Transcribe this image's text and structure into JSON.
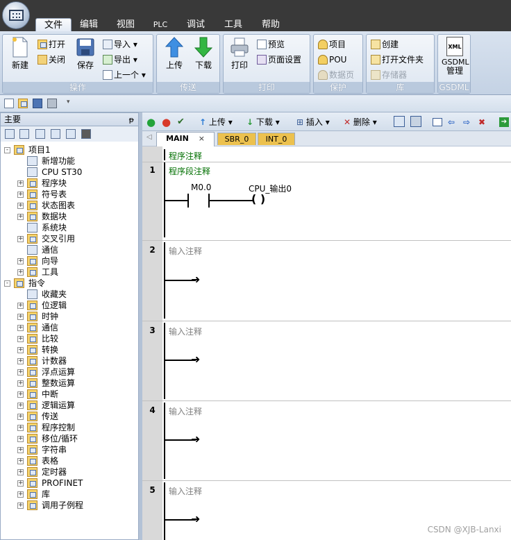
{
  "menu": {
    "items": [
      "文件",
      "编辑",
      "视图",
      "PLC",
      "调试",
      "工具",
      "帮助"
    ],
    "active": "文件"
  },
  "ribbon": {
    "groups": [
      {
        "label": "操作"
      },
      {
        "label": "传送"
      },
      {
        "label": "打印"
      },
      {
        "label": "保护"
      },
      {
        "label": "库"
      },
      {
        "label": "GSDML"
      }
    ],
    "new_label": "新建",
    "open_label": "打开",
    "close_label": "关闭",
    "save_label": "保存",
    "import_label": "导入",
    "export_label": "导出",
    "previous_label": "上一个",
    "upload_label": "上传",
    "download_label": "下载",
    "print_label": "打印",
    "preview_label": "预览",
    "page_setup_label": "页面设置",
    "project_label": "项目",
    "pou_label": "POU",
    "data_page_label": "数据页",
    "create_label": "创建",
    "open_folder_label": "打开文件夹",
    "memory_label": "存储器",
    "gsdml_label_1": "GSDML",
    "gsdml_label_2": "管理",
    "xml_icon_text": "XML"
  },
  "panel": {
    "title": "主要",
    "pin": "ᵽ",
    "tree": [
      {
        "label": "项目1",
        "level": 0,
        "expander": "-"
      },
      {
        "label": "新增功能",
        "level": 1,
        "expander": ""
      },
      {
        "label": "CPU ST30",
        "level": 1,
        "expander": ""
      },
      {
        "label": "程序块",
        "level": 1,
        "expander": "+"
      },
      {
        "label": "符号表",
        "level": 1,
        "expander": "+"
      },
      {
        "label": "状态图表",
        "level": 1,
        "expander": "+"
      },
      {
        "label": "数据块",
        "level": 1,
        "expander": "+"
      },
      {
        "label": "系统块",
        "level": 1,
        "expander": ""
      },
      {
        "label": "交叉引用",
        "level": 1,
        "expander": "+"
      },
      {
        "label": "通信",
        "level": 1,
        "expander": ""
      },
      {
        "label": "向导",
        "level": 1,
        "expander": "+"
      },
      {
        "label": "工具",
        "level": 1,
        "expander": "+"
      },
      {
        "label": "指令",
        "level": 0,
        "expander": "-"
      },
      {
        "label": "收藏夹",
        "level": 1,
        "expander": ""
      },
      {
        "label": "位逻辑",
        "level": 1,
        "expander": "+"
      },
      {
        "label": "时钟",
        "level": 1,
        "expander": "+"
      },
      {
        "label": "通信",
        "level": 1,
        "expander": "+"
      },
      {
        "label": "比较",
        "level": 1,
        "expander": "+"
      },
      {
        "label": "转换",
        "level": 1,
        "expander": "+"
      },
      {
        "label": "计数器",
        "level": 1,
        "expander": "+"
      },
      {
        "label": "浮点运算",
        "level": 1,
        "expander": "+"
      },
      {
        "label": "整数运算",
        "level": 1,
        "expander": "+"
      },
      {
        "label": "中断",
        "level": 1,
        "expander": "+"
      },
      {
        "label": "逻辑运算",
        "level": 1,
        "expander": "+"
      },
      {
        "label": "传送",
        "level": 1,
        "expander": "+"
      },
      {
        "label": "程序控制",
        "level": 1,
        "expander": "+"
      },
      {
        "label": "移位/循环",
        "level": 1,
        "expander": "+"
      },
      {
        "label": "字符串",
        "level": 1,
        "expander": "+"
      },
      {
        "label": "表格",
        "level": 1,
        "expander": "+"
      },
      {
        "label": "定时器",
        "level": 1,
        "expander": "+"
      },
      {
        "label": "PROFINET",
        "level": 1,
        "expander": "+"
      },
      {
        "label": "库",
        "level": 1,
        "expander": "+"
      },
      {
        "label": "调用子例程",
        "level": 1,
        "expander": "+"
      }
    ]
  },
  "editor": {
    "toolbar": {
      "upload": "上传",
      "download": "下载",
      "insert": "插入",
      "delete": "删除"
    },
    "tabs": [
      {
        "label": "MAIN",
        "active": true,
        "close": "×"
      },
      {
        "label": "SBR_0",
        "active": false
      },
      {
        "label": "INT_0",
        "active": false
      }
    ],
    "program_comment": "程序注释",
    "networks": [
      {
        "number": "1",
        "comment": "程序段注释",
        "contact": "M0.0",
        "coil": "CPU_输出0",
        "coil_symbol": "(  )"
      },
      {
        "number": "2",
        "comment": "输入注释"
      },
      {
        "number": "3",
        "comment": "输入注释"
      },
      {
        "number": "4",
        "comment": "输入注释"
      },
      {
        "number": "5",
        "comment": "输入注释"
      }
    ]
  },
  "watermark": "CSDN @XJB-Lanxi",
  "colors": {
    "menubar": "#393939",
    "ribbon": "#d0dcea",
    "group_label": "#b9c9dd",
    "tab_inactive": "#ecc14e",
    "comment_green": "#006f00",
    "gutter": "#d9d9d9"
  }
}
